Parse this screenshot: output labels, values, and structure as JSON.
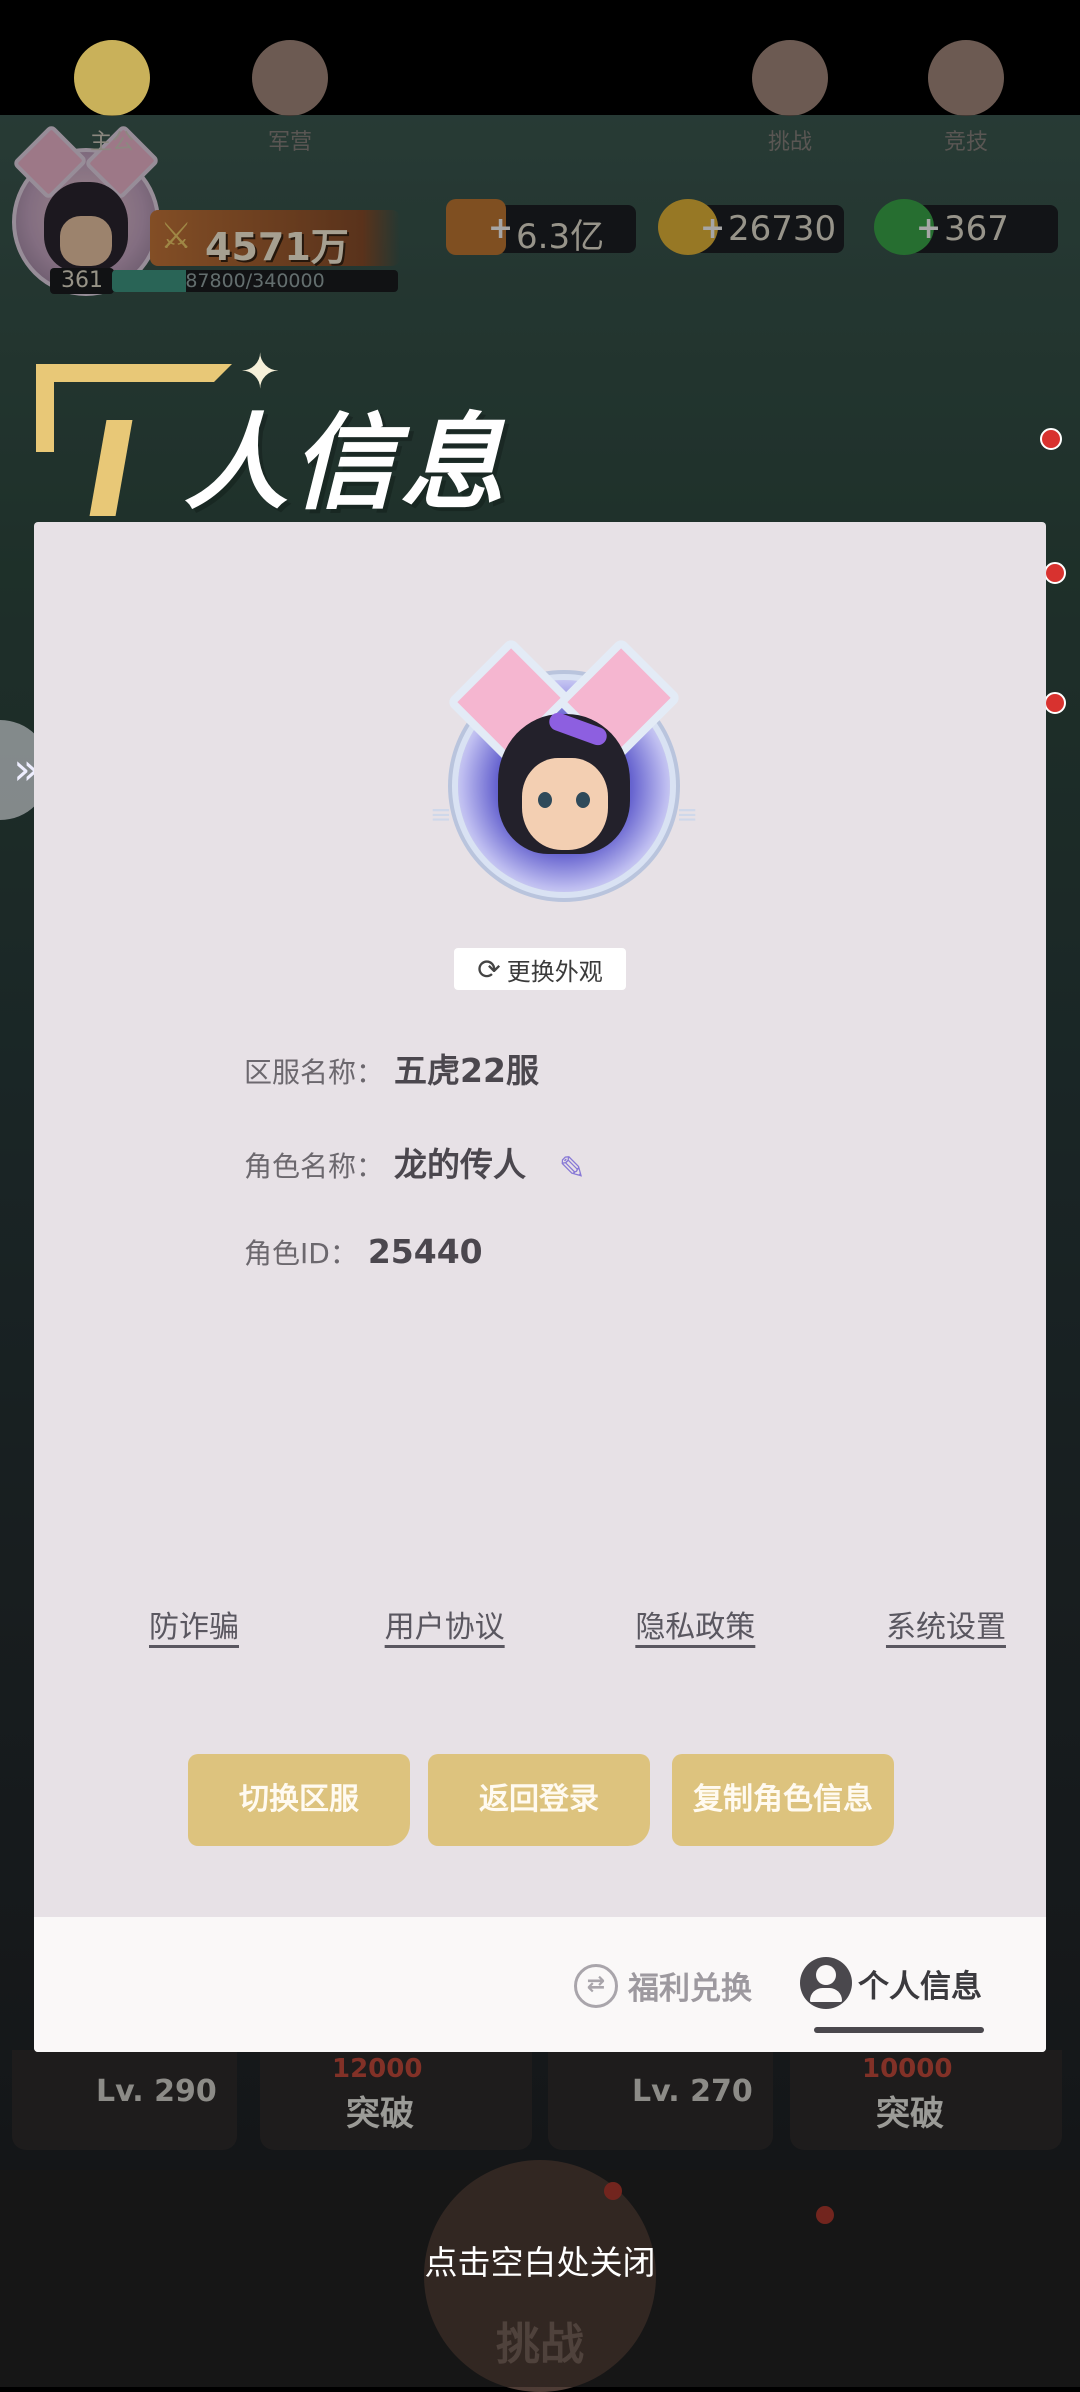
{
  "hud": {
    "level": "361",
    "xp_text": "87800/340000",
    "xp_fraction": 0.258,
    "power": "4571万",
    "resources": [
      {
        "name": "exp-icon",
        "value": "6.3亿"
      },
      {
        "name": "gold-icon",
        "value": "26730"
      },
      {
        "name": "gem-icon",
        "value": "367"
      }
    ]
  },
  "title": "人信息",
  "panel": {
    "change_skin_label": "更换外观",
    "server_label": "区服名称：",
    "server_value": "五虎22服",
    "role_label": "角色名称：",
    "role_value": "龙的传人",
    "id_label": "角色ID：",
    "id_value": "25440",
    "links": [
      "防诈骗",
      "用户协议",
      "隐私政策",
      "系统设置"
    ],
    "buttons": [
      "切换区服",
      "返回登录",
      "复制角色信息"
    ],
    "tabs": {
      "welfare": "福利兑换",
      "profile": "个人信息"
    }
  },
  "background_cards": [
    {
      "level": "Lv. 290",
      "cost": "12000",
      "action": "突破"
    },
    {
      "level": "Lv. 270",
      "cost": "10000",
      "action": "突破"
    }
  ],
  "nav": {
    "home": "主公",
    "camp": "军营",
    "center": "挑战",
    "challenge": "挑战",
    "arena": "竞技"
  },
  "close_hint": "点击空白处关闭"
}
